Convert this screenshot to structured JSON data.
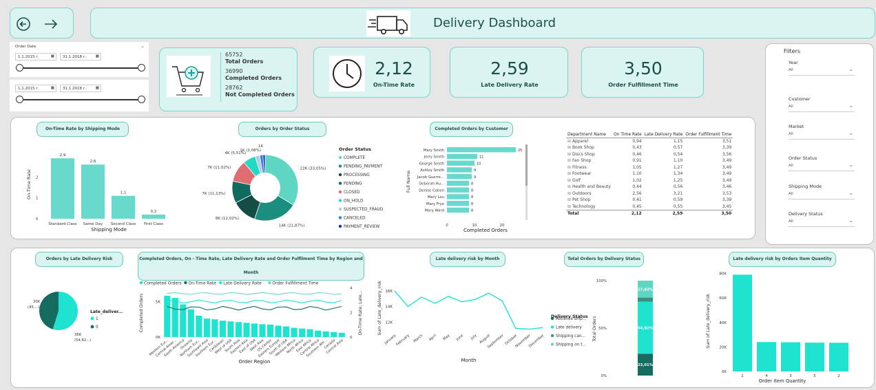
{
  "header": {
    "title": "Delivery Dashboard"
  },
  "date_slicers": [
    {
      "label": "Order Date",
      "start": "1.1.2015 г.",
      "end": "31.1.2018 г."
    },
    {
      "label": "",
      "start": "1.1.2015 г.",
      "end": "31.1.2018 г."
    }
  ],
  "orders_summary": {
    "total_value": "65752",
    "total_label": "Total Orders",
    "completed_value": "36990",
    "completed_label": "Completed Orders",
    "not_completed_value": "28762",
    "not_completed_label": "Not Completed Orders"
  },
  "kpis": [
    {
      "value": "2,12",
      "label": "On-Time Rate"
    },
    {
      "value": "2,59",
      "label": "Late Delivery Rate"
    },
    {
      "value": "3,50",
      "label": "Order Fulfillment Time"
    }
  ],
  "filters": {
    "title": "Filters",
    "items": [
      {
        "label": "Year",
        "value": "All"
      },
      {
        "label": "Customer",
        "value": "All"
      },
      {
        "label": "Market",
        "value": "All"
      },
      {
        "label": "Order Status",
        "value": "All"
      },
      {
        "label": "Shipping Mode",
        "value": "All"
      },
      {
        "label": "Delivery Status",
        "value": "All"
      }
    ]
  },
  "department_table": {
    "headers": [
      "Department Name",
      "On Time Rate",
      "Late Delivery Rate",
      "Order Fulfillment Time"
    ],
    "rows": [
      [
        "Apparel",
        "0,94",
        "1,15",
        "3,51"
      ],
      [
        "Book Shop",
        "0,43",
        "0,57",
        "3,39"
      ],
      [
        "Discs Shop",
        "0,46",
        "0,54",
        "3,56"
      ],
      [
        "Fan Shop",
        "0,91",
        "1,10",
        "3,49"
      ],
      [
        "Fitness",
        "1,05",
        "1,27",
        "3,49"
      ],
      [
        "Footwear",
        "1,10",
        "1,34",
        "3,49"
      ],
      [
        "Golf",
        "1,02",
        "1,25",
        "3,49"
      ],
      [
        "Health and Beauty",
        "0,44",
        "0,56",
        "3,46"
      ],
      [
        "Outdoors",
        "2,56",
        "3,21",
        "3,53"
      ],
      [
        "Pet Shop",
        "0,41",
        "0,59",
        "3,39"
      ],
      [
        "Technology",
        "0,45",
        "0,55",
        "3,45"
      ]
    ],
    "total": [
      "Total",
      "2,12",
      "2,59",
      "3,50"
    ]
  },
  "chart_data": [
    {
      "id": "on_time_by_shipping",
      "type": "bar",
      "title": "On-Time Rate by Shipping Mode",
      "xlabel": "Shipping Mode",
      "ylabel": "On-Time Rate",
      "categories": [
        "Standard Class",
        "Same Day",
        "Second Class",
        "First Class"
      ],
      "values": [
        2.9,
        2.6,
        1.1,
        0.2
      ],
      "value_labels": [
        "2,9",
        "2,6",
        "1,1",
        "0,2"
      ],
      "y_ticks": [
        "0",
        "1",
        "2"
      ],
      "ylim": [
        0,
        3.3
      ]
    },
    {
      "id": "orders_by_status",
      "type": "pie",
      "title": "Orders by Order Status",
      "legend_title": "Order Status",
      "legend": [
        {
          "name": "COMPLETE",
          "color": "#5fd6c4"
        },
        {
          "name": "PENDING_PAYMENT",
          "color": "#1a8f80"
        },
        {
          "name": "PROCESSING",
          "color": "#134d45"
        },
        {
          "name": "PENDING",
          "color": "#0f6b5e"
        },
        {
          "name": "CLOSED",
          "color": "#e06d72"
        },
        {
          "name": "ON_HOLD",
          "color": "#22d9c4"
        },
        {
          "name": "SUSPECTED_FRAUD",
          "color": "#b7c9e0"
        },
        {
          "name": "CANCELED",
          "color": "#2d7fe0"
        },
        {
          "name": "PAYMENT_REVIEW",
          "color": "#1a2f9c"
        }
      ],
      "values": [
        22,
        14,
        8,
        7,
        7,
        4,
        1.5,
        1,
        0.7
      ],
      "slice_labels": [
        "22K (33,05%)",
        "14K (21,87%)",
        "8K (12,02%)",
        "7K (11,13%)",
        "7K (11,02%)",
        "4K (5,51%)",
        "1K (2,08%)",
        "1K",
        ""
      ]
    },
    {
      "id": "completed_by_customer",
      "type": "bar",
      "title": "Completed Orders by Customer",
      "xlabel": "Completed Orders",
      "ylabel": "Full Name",
      "categories": [
        "Mary Smith",
        "Jerry Smith",
        "George Smith",
        "Ashley Smith",
        "Jacob Guerre...",
        "Deborah Hu...",
        "Denise Cohen",
        "Mary Lou",
        "Mary Frye",
        "Mary Ward"
      ],
      "values": [
        25,
        11,
        10,
        9,
        9,
        8,
        8,
        8,
        8,
        8
      ],
      "x_ticks": [
        "0",
        "10",
        "20"
      ],
      "xlim": [
        0,
        30
      ]
    },
    {
      "id": "late_delivery_risk_pie",
      "type": "pie",
      "title": "Orders by Late Delivery Risk",
      "legend_title": "Late_deliver...",
      "legend": [
        {
          "name": "1",
          "color": "#1de3d0"
        },
        {
          "name": "0",
          "color": "#146b5e"
        }
      ],
      "values": [
        54.82,
        45.18
      ],
      "slice_labels": [
        "36K (54,82...)",
        "30K (45,...)"
      ]
    },
    {
      "id": "region_combo",
      "type": "bar",
      "title": "Completed Orders, On - Time Rate, Late Delivery Rate and Order Fulfilment Time by Region and Month",
      "xlabel": "Order Region",
      "ylabel": "Completed Orders",
      "ylabel_right": "On-Time Rate, Late...",
      "legend": [
        {
          "name": "Completed Orders",
          "color": "#1de3d0"
        },
        {
          "name": "On-Time Rate",
          "color": "#146b5e"
        },
        {
          "name": "Late Delivery Rate",
          "color": "#1de3d0"
        },
        {
          "name": "Order Fulfillment Time",
          "color": "#6fd6c4"
        }
      ],
      "categories": [
        "Western Eur...",
        "Central Amer...",
        "South America",
        "Oceania",
        "Northern Eur...",
        "Southeast Asia",
        "Southern Eur...",
        "Caribbean",
        "West of USA",
        "South Asia",
        "Eastern Asia",
        "East of USA",
        "West Asia",
        "US Center",
        "Eastern Europe",
        "South of USA",
        "Western Africa",
        "North Africa",
        "East Africa",
        "Central Africa",
        "Southern Afri...",
        "Canada",
        "Central Asia"
      ],
      "values": [
        5800,
        5500,
        4600,
        3900,
        3000,
        2600,
        2500,
        2300,
        2200,
        2100,
        2000,
        1900,
        1800,
        1750,
        1600,
        1500,
        1300,
        1200,
        1100,
        900,
        800,
        700,
        600
      ],
      "y_ticks": [
        "0K",
        "5K"
      ],
      "ylim": [
        0,
        6000
      ],
      "right_ticks": [
        "0",
        "2",
        "4"
      ],
      "rlim": [
        0,
        4
      ]
    },
    {
      "id": "late_risk_by_month",
      "type": "line",
      "title": "Late delivery risk by Month",
      "xlabel": "Month",
      "ylabel": "Sum of Late_delivery_risk",
      "categories": [
        "January",
        "February",
        "March",
        "April",
        "May",
        "June",
        "July",
        "August",
        "September",
        "October",
        "November",
        "December"
      ],
      "values": [
        16000,
        14000,
        15200,
        14400,
        15300,
        14600,
        14900,
        15700,
        14700,
        11200,
        11100,
        11300
      ],
      "y_ticks": [
        "12K",
        "14K",
        "16K"
      ],
      "ylim": [
        10800,
        16600
      ]
    },
    {
      "id": "total_orders_by_delivery_status",
      "type": "bar",
      "title": "Total Orders by Delivery Status",
      "ylabel": "Total Orders",
      "legend_title": "Delivery Status",
      "legend": [
        {
          "name": "Advance ship...",
          "color": "#146b5e"
        },
        {
          "name": "Late delivery",
          "color": "#1de3d0"
        },
        {
          "name": "Shipping can...",
          "color": "#3a8f84"
        },
        {
          "name": "Shipping on t...",
          "color": "#5fd6c4"
        }
      ],
      "segments": [
        {
          "name": "Advance ship...",
          "value": 23.01,
          "color": "#146b5e",
          "label": "23,01%"
        },
        {
          "name": "Late delivery",
          "value": 54.82,
          "color": "#1de3d0",
          "label": "54,82%"
        },
        {
          "name": "Shipping can...",
          "value": 4.34,
          "color": "#3a8f84",
          "label": ""
        },
        {
          "name": "Shipping on t...",
          "value": 17.83,
          "color": "#5fd6c4",
          "label": "17,83%"
        }
      ],
      "y_ticks": [
        "0%",
        "50%",
        "100%"
      ]
    },
    {
      "id": "late_risk_by_qty",
      "type": "bar",
      "title": "Late delivery risk by Orders Item Quantity",
      "xlabel": "Order Item Quantity",
      "ylabel": "Sum of Late_delivery_risk",
      "categories": [
        "1",
        "4",
        "3",
        "5",
        "2"
      ],
      "values": [
        79000,
        24000,
        23800,
        23500,
        23400
      ],
      "y_ticks": [
        "0K",
        "20K",
        "40K",
        "60K",
        "80K"
      ],
      "ylim": [
        0,
        82000
      ]
    }
  ]
}
